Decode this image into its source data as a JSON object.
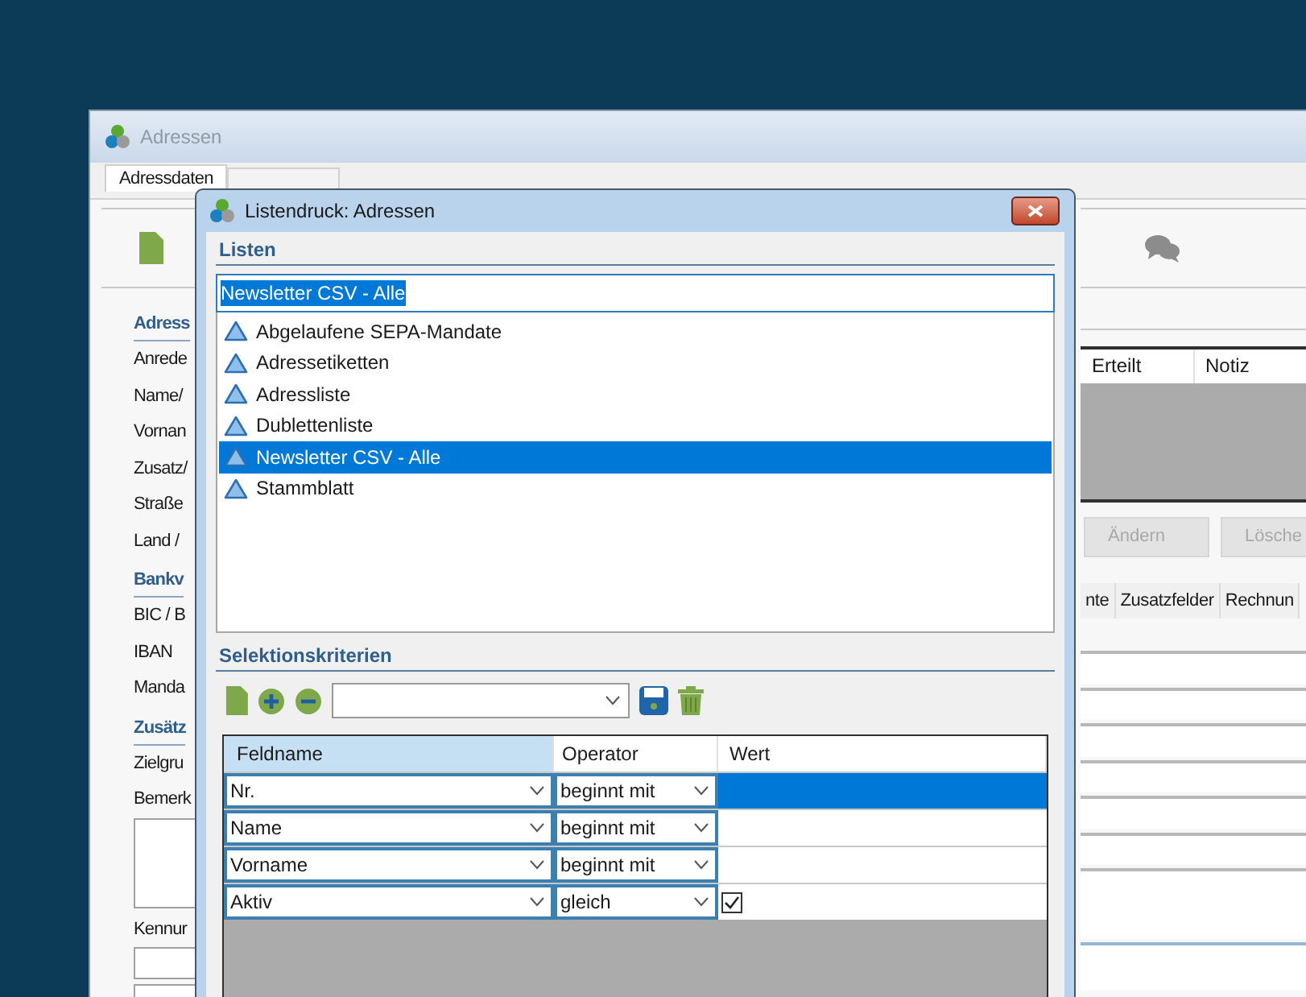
{
  "main_window": {
    "title": "Adressen",
    "tabs": [
      {
        "label": "Adressdaten",
        "selected": true
      }
    ],
    "left_form": [
      {
        "kind": "section",
        "text": "Adress"
      },
      {
        "kind": "label",
        "text": "Anrede"
      },
      {
        "kind": "label",
        "text": "Name/"
      },
      {
        "kind": "label",
        "text": "Vornan"
      },
      {
        "kind": "label",
        "text": "Zusatz/"
      },
      {
        "kind": "label",
        "text": "Straße"
      },
      {
        "kind": "label",
        "text": "Land /"
      },
      {
        "kind": "section",
        "text": "Bankv"
      },
      {
        "kind": "label",
        "text": "BIC / B"
      },
      {
        "kind": "label",
        "text": "IBAN"
      },
      {
        "kind": "label",
        "text": "Manda"
      },
      {
        "kind": "section",
        "text": "Zusätz"
      },
      {
        "kind": "label",
        "text": "Zielgru"
      },
      {
        "kind": "label",
        "text": "Bemerk"
      },
      {
        "kind": "textarea"
      },
      {
        "kind": "label",
        "text": "Kennur"
      },
      {
        "kind": "input"
      },
      {
        "kind": "input"
      }
    ],
    "mandate_table": {
      "columns": [
        "Erteilt",
        "Notiz"
      ]
    },
    "buttons": [
      {
        "label": "Ändern",
        "disabled": true
      },
      {
        "label": "Lösche",
        "disabled": true
      }
    ],
    "lower_tabs": [
      {
        "label": "nte",
        "selected": false
      },
      {
        "label": "Zusatzfelder",
        "selected": false
      },
      {
        "label": "Rechnun",
        "selected": false
      }
    ]
  },
  "dialog": {
    "title": "Listendruck: Adressen",
    "lists_header": "Listen",
    "list_input": {
      "value": "Newsletter CSV - Alle",
      "text_selected": true
    },
    "lists": [
      {
        "label": "Abgelaufene SEPA-Mandate",
        "selected": false
      },
      {
        "label": "Adressetiketten",
        "selected": false
      },
      {
        "label": "Adressliste",
        "selected": false
      },
      {
        "label": "Dublettenliste",
        "selected": false
      },
      {
        "label": "Newsletter CSV - Alle",
        "selected": true
      },
      {
        "label": "Stammblatt",
        "selected": false
      }
    ],
    "criteria_header": "Selektionskriterien",
    "grid": {
      "columns": [
        {
          "label": "Feldname",
          "selected": true
        },
        {
          "label": "Operator",
          "selected": false
        },
        {
          "label": "Wert",
          "selected": false
        }
      ],
      "rows": [
        {
          "field": "Nr.",
          "operator": "beginnt mit",
          "kind": "text",
          "selected": true
        },
        {
          "field": "Name",
          "operator": "beginnt mit",
          "kind": "text",
          "selected": false
        },
        {
          "field": "Vorname",
          "operator": "beginnt mit",
          "kind": "text",
          "selected": false
        },
        {
          "field": "Aktiv",
          "operator": "gleich",
          "kind": "checkbox",
          "checked": true,
          "selected": false
        }
      ]
    }
  }
}
